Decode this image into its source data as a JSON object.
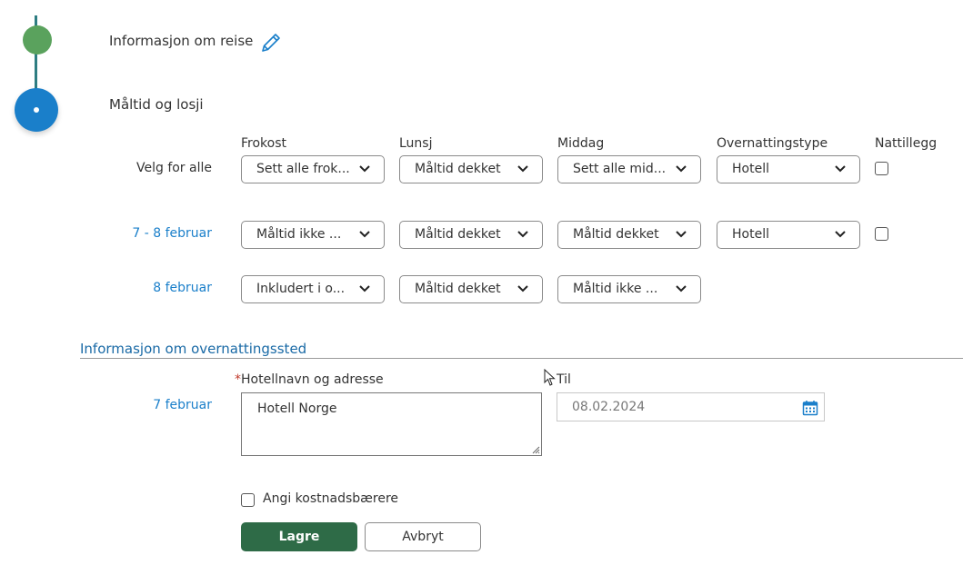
{
  "stepper": {
    "step1": {
      "title": "Informasjon om reise",
      "status": "done",
      "color": "#5aa25d"
    },
    "step2": {
      "title": "Måltid og losji",
      "status": "active",
      "color": "#1a7fca"
    }
  },
  "columns": {
    "frokost": "Frokost",
    "lunsj": "Lunsj",
    "middag": "Middag",
    "overnattingstype": "Overnattingstype",
    "nattillegg": "Nattillegg"
  },
  "rows": {
    "all": {
      "label": "Velg for alle",
      "frokost": "Sett alle frok...",
      "lunsj": "Måltid dekket",
      "middag": "Sett alle mid...",
      "overnattingstype": "Hotell"
    },
    "r1": {
      "label": "7 - 8 februar",
      "frokost": "Måltid ikke ...",
      "lunsj": "Måltid dekket",
      "middag": "Måltid dekket",
      "overnattingstype": "Hotell"
    },
    "r2": {
      "label": "8 februar",
      "frokost": "Inkludert i o...",
      "lunsj": "Måltid dekket",
      "middag": "Måltid ikke ..."
    }
  },
  "lodging": {
    "section_title": "Informasjon om overnattingssted",
    "date_label": "7 februar",
    "hotel_label_required": "*",
    "hotel_label": "Hotellnavn og adresse",
    "hotel_value": "Hotell Norge",
    "til_label": "Til",
    "til_value": "08.02.2024"
  },
  "cost_bearer_label": "Angi kostnadsbærere",
  "buttons": {
    "save": "Lagre",
    "cancel": "Avbryt"
  },
  "colors": {
    "link": "#1a7fca",
    "primary_button": "#2e6b47",
    "section_title": "#1a6aa6"
  },
  "icons": [
    "edit-pencil-icon",
    "chevron-down-icon",
    "calendar-icon",
    "resize-handle-icon",
    "mouse-cursor-icon"
  ]
}
